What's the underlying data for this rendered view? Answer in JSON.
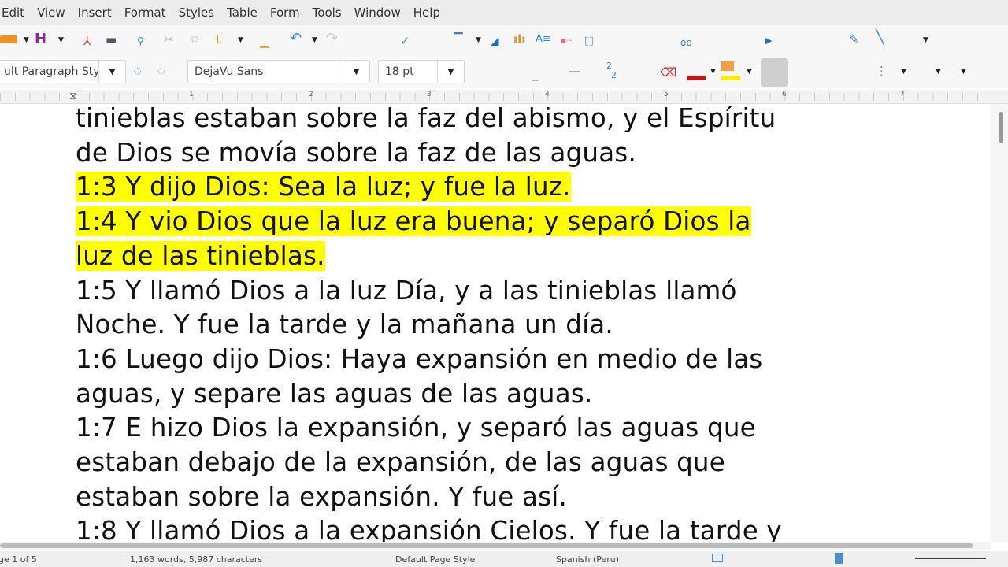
{
  "menu": [
    "Edit",
    "View",
    "Insert",
    "Format",
    "Styles",
    "Table",
    "Form",
    "Tools",
    "Window",
    "Help"
  ],
  "toolbar": {
    "paragraph_style": "ult Paragraph Sty",
    "font_name": "DejaVu Sans",
    "font_size": "18 pt"
  },
  "ruler": {
    "marks": [
      "1",
      "2",
      "3",
      "4",
      "5",
      "6",
      "7"
    ]
  },
  "document": {
    "highlight_color": "#ffff00",
    "lines": [
      {
        "text": "tinieblas estaban sobre la faz del abismo, y el Espíritu",
        "highlighted": false
      },
      {
        "text": "de Dios se movía sobre la faz de las aguas.",
        "highlighted": false
      },
      {
        "text": "1:3 Y dijo Dios: Sea la luz; y fue la luz.",
        "highlighted": true
      },
      {
        "text": "1:4 Y vio Dios que la luz era buena; y separó Dios la",
        "highlighted": true
      },
      {
        "text": "luz de las tinieblas.",
        "highlighted": true
      },
      {
        "text": "1:5 Y llamó Dios a la luz Día, y a las tinieblas llamó",
        "highlighted": false
      },
      {
        "text": "Noche. Y fue la tarde y la mañana un día.",
        "highlighted": false
      },
      {
        "text": "1:6 Luego dijo Dios: Haya expansión en medio de las",
        "highlighted": false
      },
      {
        "text": "aguas, y separe las aguas de las aguas.",
        "highlighted": false
      },
      {
        "text": "1:7 E hizo Dios la expansión, y separó las aguas que",
        "highlighted": false
      },
      {
        "text": "estaban debajo de la expansión, de las aguas que",
        "highlighted": false
      },
      {
        "text": "estaban sobre la expansión. Y fue así.",
        "highlighted": false
      },
      {
        "text": "1:8 Y llamó Dios a la expansión Cielos. Y fue la tarde y",
        "highlighted": false
      }
    ]
  },
  "status": {
    "page": "ge 1 of 5",
    "words": "1,163 words, 5,987 characters",
    "page_style": "Default Page Style",
    "language": "Spanish (Peru)"
  }
}
